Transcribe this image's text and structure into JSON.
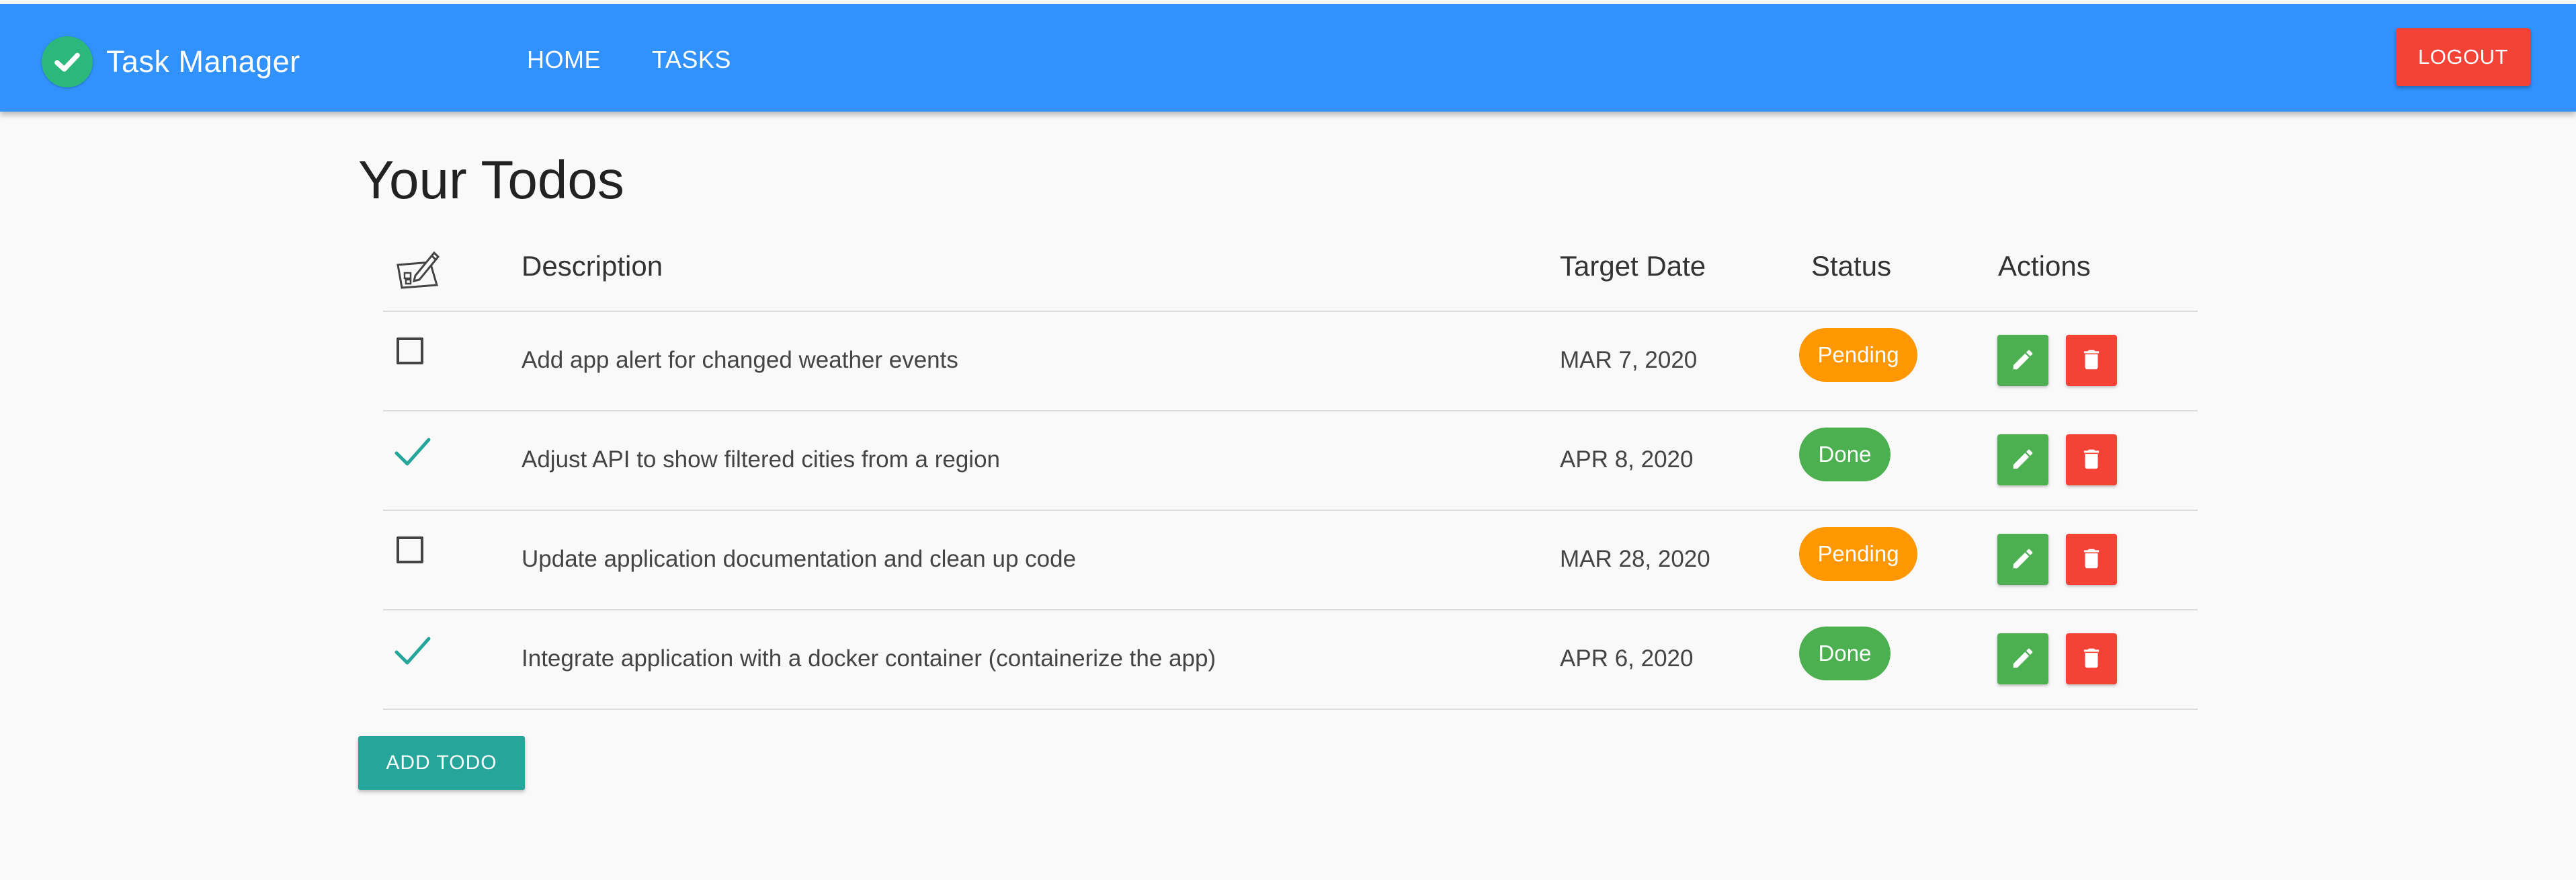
{
  "app": {
    "title": "Task Manager",
    "brand_color": "#3292fd",
    "logo_icon": "check-circle-icon"
  },
  "nav": {
    "items": [
      {
        "label": "HOME"
      },
      {
        "label": "TASKS"
      }
    ],
    "logout_label": "LOGOUT"
  },
  "page": {
    "title": "Your Todos"
  },
  "table": {
    "header_icon": "edit-checklist-icon",
    "headers": {
      "description": "Description",
      "target_date": "Target Date",
      "status": "Status",
      "actions": "Actions"
    },
    "rows": [
      {
        "done": false,
        "description": "Add app alert for changed weather events",
        "target_date": "MAR 7, 2020",
        "status": "Pending"
      },
      {
        "done": true,
        "description": "Adjust API to show filtered cities from a region",
        "target_date": "APR 8, 2020",
        "status": "Done"
      },
      {
        "done": false,
        "description": "Update application documentation and clean up code",
        "target_date": "MAR 28, 2020",
        "status": "Pending"
      },
      {
        "done": true,
        "description": "Integrate application with a docker container (containerize the app)",
        "target_date": "APR 6, 2020",
        "status": "Done"
      }
    ]
  },
  "add_button_label": "ADD TODO",
  "colors": {
    "pending": "#ff9800",
    "done": "#4caf50",
    "delete": "#f44336",
    "edit": "#4caf50",
    "add": "#26a69a",
    "checkmark": "#26a69a"
  }
}
